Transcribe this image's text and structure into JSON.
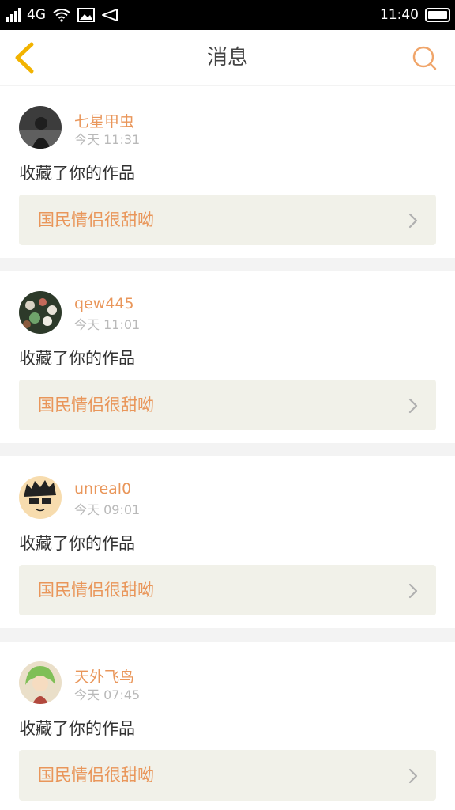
{
  "status_bar": {
    "network": "4G",
    "time": "11:40"
  },
  "header": {
    "title": "消息"
  },
  "colors": {
    "accent": "#e9965a",
    "back_icon": "#f2b300",
    "card_bg": "#f1f1e9"
  },
  "icons": {
    "back": "chevron-left-icon",
    "search": "search-icon",
    "work_arrow": "chevron-right-icon"
  },
  "messages": [
    {
      "user": "七星甲虫",
      "time": "今天 11:31",
      "action": "收藏了你的作品",
      "work_title": "国民情侣很甜呦"
    },
    {
      "user": "qew445",
      "time": "今天 11:01",
      "action": "收藏了你的作品",
      "work_title": "国民情侣很甜呦"
    },
    {
      "user": "unreal0",
      "time": "今天 09:01",
      "action": "收藏了你的作品",
      "work_title": "国民情侣很甜呦"
    },
    {
      "user": "天外飞鸟",
      "time": "今天 07:45",
      "action": "收藏了你的作品",
      "work_title": "国民情侣很甜呦"
    }
  ]
}
